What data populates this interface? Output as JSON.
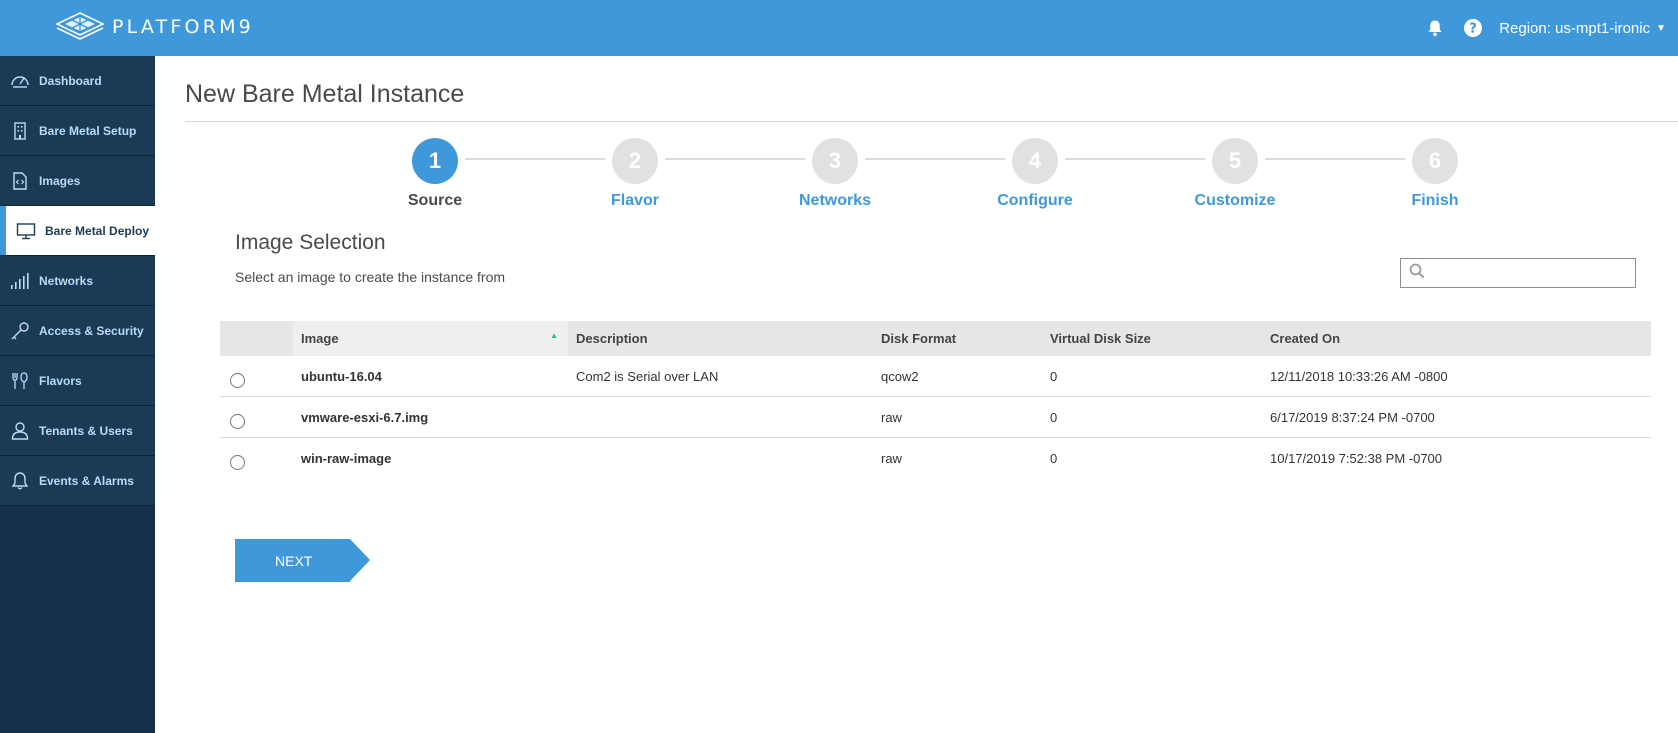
{
  "header": {
    "brand": "PLATFORM9",
    "region_label": "Region: us-mpt1-ironic",
    "icons": [
      "bell-icon",
      "help-icon"
    ]
  },
  "sidebar": {
    "items": [
      {
        "label": "Dashboard",
        "icon": "speedometer-icon"
      },
      {
        "label": "Bare Metal Setup",
        "icon": "building-icon"
      },
      {
        "label": "Images",
        "icon": "file-code-icon"
      },
      {
        "label": "Bare Metal Deploy",
        "icon": "monitor-icon",
        "active": true
      },
      {
        "label": "Networks",
        "icon": "signal-bars-icon"
      },
      {
        "label": "Access & Security",
        "icon": "key-icon"
      },
      {
        "label": "Flavors",
        "icon": "utensils-icon"
      },
      {
        "label": "Tenants & Users",
        "icon": "user-icon"
      },
      {
        "label": "Events & Alarms",
        "icon": "bell-outline-icon"
      }
    ]
  },
  "page": {
    "title": "New Bare Metal Instance"
  },
  "stepper": {
    "steps": [
      {
        "number": "1",
        "label": "Source",
        "active": true
      },
      {
        "number": "2",
        "label": "Flavor"
      },
      {
        "number": "3",
        "label": "Networks"
      },
      {
        "number": "4",
        "label": "Configure"
      },
      {
        "number": "5",
        "label": "Customize"
      },
      {
        "number": "6",
        "label": "Finish"
      }
    ]
  },
  "section": {
    "title": "Image Selection",
    "subtitle": "Select an image to create the instance from",
    "search_placeholder": ""
  },
  "table": {
    "columns": [
      "",
      "Image",
      "Description",
      "Disk Format",
      "Virtual Disk Size",
      "Created On"
    ],
    "sorted_column": "Image",
    "rows": [
      {
        "image": "ubuntu-16.04",
        "description": "Com2 is Serial over LAN",
        "disk_format": "qcow2",
        "virtual_disk_size": "0",
        "created_on": "12/11/2018 10:33:26 AM -0800"
      },
      {
        "image": "vmware-esxi-6.7.img",
        "description": "",
        "disk_format": "raw",
        "virtual_disk_size": "0",
        "created_on": "6/17/2019 8:37:24 PM -0700"
      },
      {
        "image": "win-raw-image",
        "description": "",
        "disk_format": "raw",
        "virtual_disk_size": "0",
        "created_on": "10/17/2019 7:52:38 PM -0700"
      }
    ]
  },
  "actions": {
    "next_label": "NEXT"
  },
  "colors": {
    "primary": "#3e98d9",
    "sidebar_bg": "#1b3a56",
    "sidebar_text": "#b6dcf6",
    "sort_indicator": "#2db38f"
  }
}
